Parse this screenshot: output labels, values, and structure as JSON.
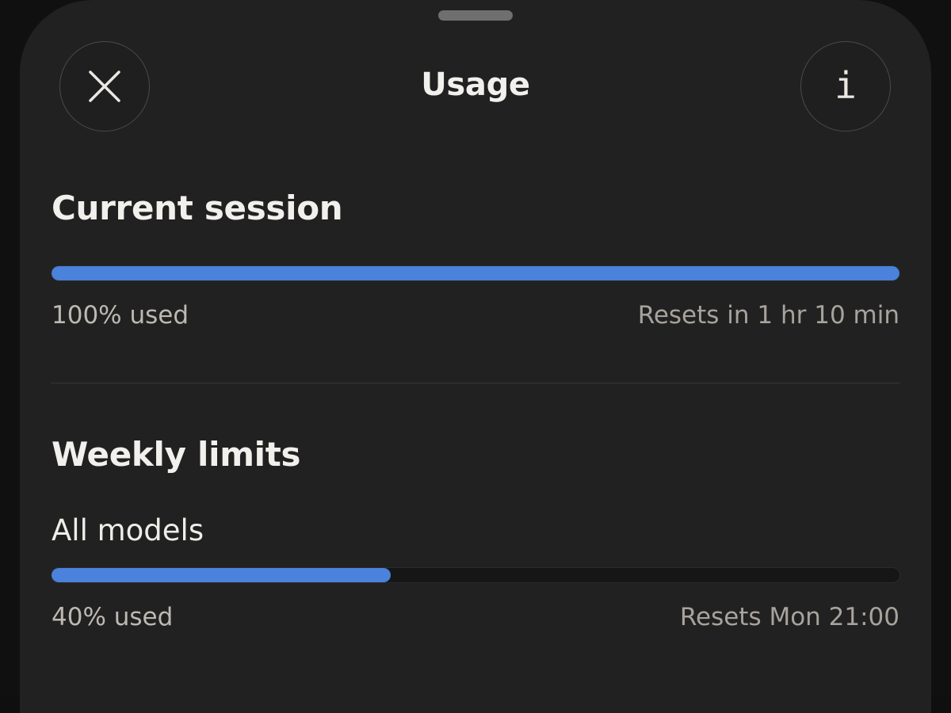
{
  "header": {
    "title": "Usage",
    "close_icon": "close-icon",
    "info_icon": "info-icon",
    "info_glyph": "i"
  },
  "current_session": {
    "heading": "Current session",
    "used_label": "100% used",
    "used_fraction": 1.0,
    "reset_label": "Resets in 1 hr 10 min"
  },
  "weekly_limits": {
    "heading": "Weekly limits",
    "models": [
      {
        "name": "All models",
        "used_label": "40% used",
        "used_fraction": 0.4,
        "reset_label": "Resets Mon 21:00"
      }
    ]
  },
  "colors": {
    "accent": "#4a82dc",
    "sheet_background": "#212121",
    "text_primary": "#f2f0ec",
    "text_secondary": "#a7a39c"
  }
}
